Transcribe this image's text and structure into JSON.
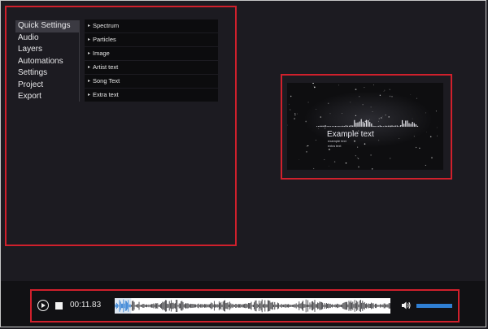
{
  "menu": {
    "items": [
      "Quick Settings",
      "Audio",
      "Layers",
      "Automations",
      "Settings",
      "Project",
      "Export"
    ],
    "active": "Quick Settings"
  },
  "subpanel": {
    "items": [
      "Spectrum",
      "Particles",
      "Image",
      "Artist text",
      "Song Text",
      "Extra text"
    ]
  },
  "preview": {
    "title": "Example text",
    "artist": "example text",
    "extra": "extra text"
  },
  "player": {
    "time": "00:11.83",
    "progress": 0.06,
    "volume": 1.0,
    "accent_color": "#2f7fd4",
    "play_icon": "play-circle-icon",
    "stop_icon": "stop-icon",
    "volume_icon": "speaker-icon"
  },
  "highlight_color": "#d0202c"
}
